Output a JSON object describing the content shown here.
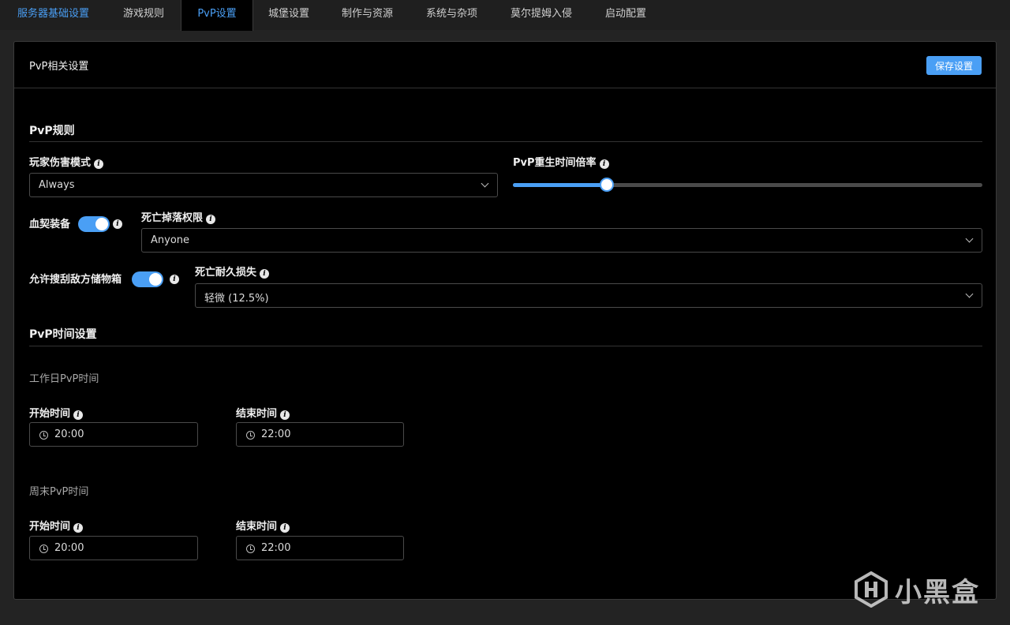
{
  "tabs": [
    {
      "label": "服务器基础设置"
    },
    {
      "label": "游戏规则"
    },
    {
      "label": "PvP设置"
    },
    {
      "label": "城堡设置"
    },
    {
      "label": "制作与资源"
    },
    {
      "label": "系统与杂项"
    },
    {
      "label": "莫尔提姆入侵"
    },
    {
      "label": "启动配置"
    }
  ],
  "active_tab": "PvP设置",
  "card": {
    "title": "PvP相关设置",
    "save_label": "保存设置"
  },
  "pvp_rules": {
    "title": "PvP规则",
    "damage_mode": {
      "label": "玩家伤害模式",
      "value": "Always"
    },
    "respawn_rate": {
      "label": "PvP重生时间倍率",
      "fraction": 0.2
    },
    "blood_bound": {
      "label": "血契装备",
      "on": true
    },
    "death_loot": {
      "label": "死亡掉落权限",
      "value": "Anyone"
    },
    "loot_storage": {
      "label": "允许搜刮敌方储物箱",
      "on": true
    },
    "durability_loss": {
      "label": "死亡耐久损失",
      "value": "轻微 (12.5%)"
    }
  },
  "pvp_time": {
    "title": "PvP时间设置",
    "weekday": {
      "title": "工作日PvP时间",
      "start_label": "开始时间",
      "start_value": "20:00",
      "end_label": "结束时间",
      "end_value": "22:00"
    },
    "weekend": {
      "title": "周末PvP时间",
      "start_label": "开始时间",
      "start_value": "20:00",
      "end_label": "结束时间",
      "end_value": "22:00"
    }
  },
  "watermark": {
    "text": "小黑盒"
  },
  "colors": {
    "accent": "#4a9ff5",
    "background": "#000000",
    "page": "#232323"
  },
  "icons": {
    "info": "info-icon",
    "chevron": "chevron-down-icon",
    "clock": "clock-icon"
  }
}
